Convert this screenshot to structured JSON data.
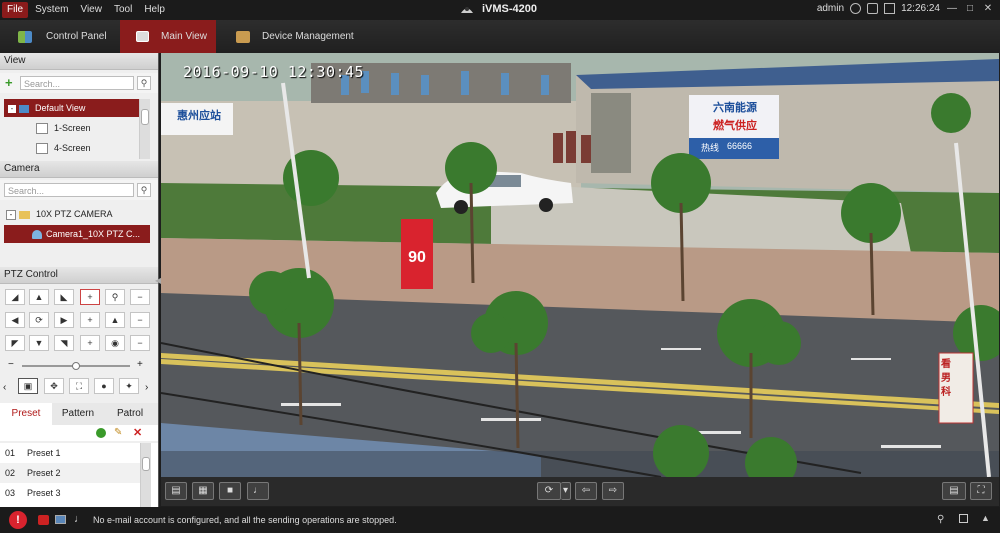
{
  "titlebar": {
    "menus": [
      "File",
      "System",
      "View",
      "Tool",
      "Help"
    ],
    "app_title": "iVMS-4200",
    "user": "admin",
    "time": "12:26:24"
  },
  "nav": {
    "tabs": [
      {
        "label": "Control Panel"
      },
      {
        "label": "Main View"
      },
      {
        "label": "Device Management"
      }
    ]
  },
  "view_panel": {
    "title": "View",
    "search_placeholder": "Search...",
    "items": [
      "Default View",
      "1-Screen",
      "4-Screen"
    ]
  },
  "camera_panel": {
    "title": "Camera",
    "search_placeholder": "Search...",
    "group": "10X PTZ CAMERA",
    "camera": "Camera1_10X PTZ C..."
  },
  "ptz": {
    "title": "PTZ Control",
    "speed": 0.5,
    "tabs": [
      "Preset",
      "Pattern",
      "Patrol"
    ],
    "presets": [
      {
        "num": "01",
        "name": "Preset 1"
      },
      {
        "num": "02",
        "name": "Preset 2"
      },
      {
        "num": "03",
        "name": "Preset 3"
      }
    ]
  },
  "video": {
    "osd": "2016-09-10 12:30:45",
    "sign_top": "惠州应站",
    "sign_price": "90",
    "billboard_top": "六南能源",
    "billboard_mid": "燃气供应",
    "billboard_phone_label": "热线",
    "billboard_phone": "66666",
    "road_sign": "看男科"
  },
  "status": {
    "message": "No e-mail account is configured, and all the sending operations are stopped."
  }
}
